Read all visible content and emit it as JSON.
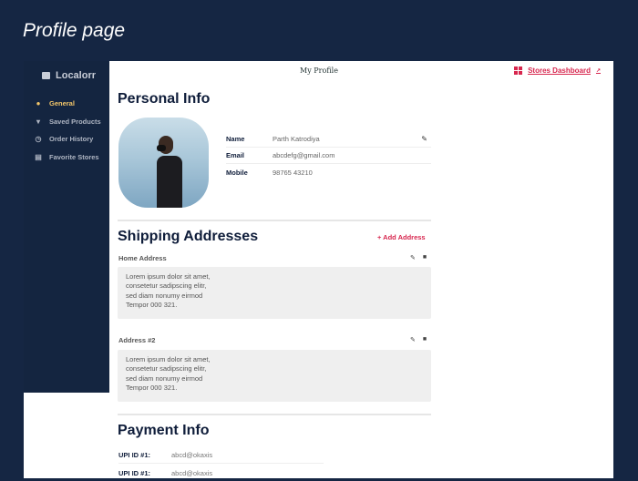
{
  "page_title": "Profile page",
  "sidebar": {
    "brand": "Localorr",
    "items": [
      {
        "label": "General",
        "icon": "info-icon"
      },
      {
        "label": "Saved Products",
        "icon": "basket-icon"
      },
      {
        "label": "Order History",
        "icon": "history-icon"
      },
      {
        "label": "Favorite Stores",
        "icon": "store-icon"
      }
    ]
  },
  "header": {
    "title": "My Profile",
    "stores_dashboard": "Stores Dashboard",
    "ext": "↗"
  },
  "personal": {
    "heading": "Personal Info",
    "rows": [
      {
        "k": "Name",
        "v": "Parth Katrodiya"
      },
      {
        "k": "Email",
        "v": "abcdefg@gmail.com"
      },
      {
        "k": "Mobile",
        "v": "98765 43210"
      }
    ]
  },
  "shipping": {
    "heading": "Shipping Addresses",
    "add": "+ Add Address",
    "addresses": [
      {
        "label": "Home Address",
        "lines": [
          "Lorem ipsum dolor sit amet,",
          "consetetur sadipscing elitr,",
          "sed diam nonumy eirmod",
          "Tempor 000 321."
        ]
      },
      {
        "label": "Address #2",
        "lines": [
          "Lorem ipsum dolor sit amet,",
          "consetetur sadipscing elitr,",
          "sed diam nonumy eirmod",
          "Tempor 000 321."
        ]
      }
    ]
  },
  "payment": {
    "heading": "Payment Info",
    "rows": [
      {
        "k": "UPI ID #1:",
        "v": "abcd@okaxis"
      },
      {
        "k": "UPI ID #1:",
        "v": "abcd@okaxis"
      }
    ]
  }
}
